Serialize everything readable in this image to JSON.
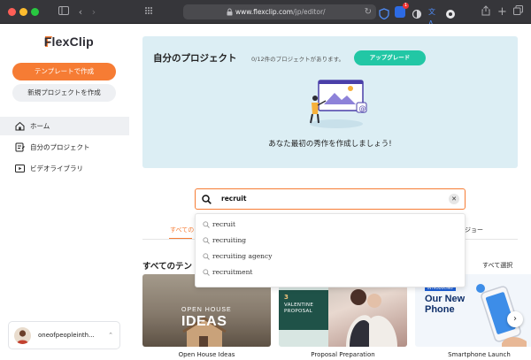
{
  "browser": {
    "url_domain": "www.flexclip.com",
    "url_path": "/jp/editor/"
  },
  "sidebar": {
    "logo": "FlexClip",
    "create_template_label": "テンプレートで作成",
    "create_project_label": "新規プロジェクトを作成",
    "nav": [
      {
        "label": "ホーム",
        "icon": "home-icon",
        "active": true
      },
      {
        "label": "自分のプロジェクト",
        "icon": "project-icon",
        "active": false
      },
      {
        "label": "ビデオライブラリ",
        "icon": "video-library-icon",
        "active": false
      }
    ],
    "user_name": "oneofpeopleinth..."
  },
  "hero": {
    "title": "自分のプロジェクト",
    "count_text": "0/12件のプロジェクトがあります。",
    "upgrade_label": "アップグレード",
    "message": "あなた最初の秀作を作成しましょう!"
  },
  "search": {
    "value": "recruit",
    "suggestions": [
      "recruit",
      "recruiting",
      "recruiting agency",
      "recruitment"
    ]
  },
  "tabs": {
    "first": "すべての",
    "last": "ジョー"
  },
  "section": {
    "title": "すべてのテン",
    "select_all": "すべて選択"
  },
  "templates": [
    {
      "label": "Open House Ideas",
      "line1": "OPEN HOUSE",
      "line2": "IDEAS"
    },
    {
      "label": "Proposal Preparation",
      "number": "3",
      "line1": "VALENTINE",
      "line2": "PROPOSAL"
    },
    {
      "label": "Smartphone Launch",
      "tag": "INTRODUCING",
      "line1": "Our New",
      "line2": "Phone"
    }
  ],
  "colors": {
    "accent": "#f67c34",
    "upgrade": "#22c7a5",
    "hero_bg": "#dceef4"
  }
}
